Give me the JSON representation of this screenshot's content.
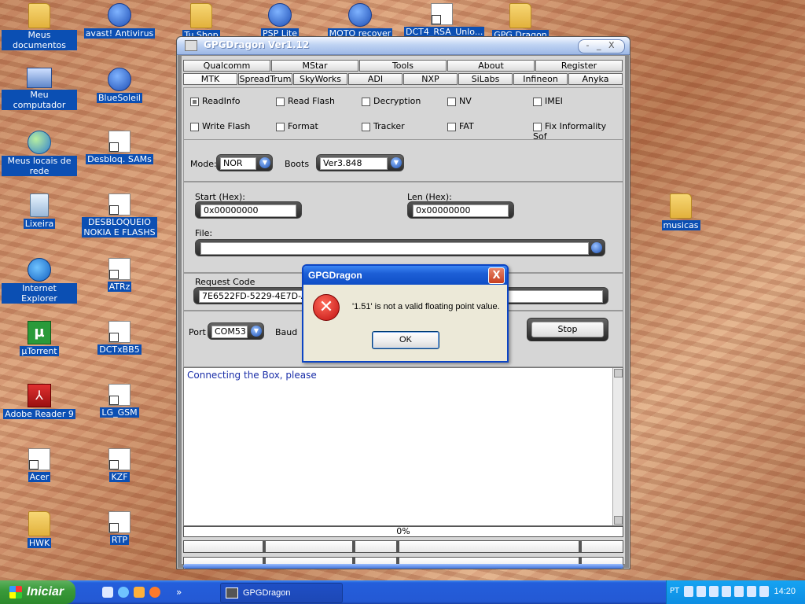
{
  "desktop": {
    "icons": [
      {
        "label": "Meus documentos",
        "icon": "folder-icon"
      },
      {
        "label": "avast! Antivirus",
        "icon": "avast-icon"
      },
      {
        "label": "Meu computador",
        "icon": "computer-icon"
      },
      {
        "label": "BlueSoleil",
        "icon": "bluetooth-icon"
      },
      {
        "label": "Meus locais de rede",
        "icon": "network-icon"
      },
      {
        "label": "Desbloq. SAMs",
        "icon": "shortcut-icon"
      },
      {
        "label": "Lixeira",
        "icon": "recycle-bin-icon"
      },
      {
        "label": "DESBLOQUEIO NOKIA E FLASHS",
        "icon": "shortcut-icon"
      },
      {
        "label": "Internet Explorer",
        "icon": "ie-icon"
      },
      {
        "label": "ATRz",
        "icon": "shortcut-icon"
      },
      {
        "label": "µTorrent",
        "icon": "utorrent-icon"
      },
      {
        "label": "DCTxBB5",
        "icon": "shortcut-icon"
      },
      {
        "label": "Adobe Reader 9",
        "icon": "pdf-icon"
      },
      {
        "label": "LG_GSM",
        "icon": "shortcut-icon"
      },
      {
        "label": "Acer",
        "icon": "shortcut-icon"
      },
      {
        "label": "KZF",
        "icon": "shortcut-icon"
      },
      {
        "label": "HWK",
        "icon": "folder-icon"
      },
      {
        "label": "RTP",
        "icon": "shortcut-icon"
      },
      {
        "label": "musicas",
        "icon": "folder-icon"
      }
    ],
    "top_partial_labels": [
      "Tu Shop",
      "PSP Lite",
      "MOTO recover",
      "DCT4_RSA_Unlo...",
      "GPG Dragon"
    ]
  },
  "window": {
    "title": "GPGDragon Ver1.12",
    "title_buttons": "- _ X",
    "tabs_row1": [
      "Qualcomm",
      "MStar",
      "Tools",
      "About",
      "Register"
    ],
    "tabs_row2": [
      "MTK",
      "SpreadTrum",
      "SkyWorks",
      "ADI",
      "NXP",
      "SiLabs",
      "Infineon",
      "Anyka"
    ],
    "checkboxes": [
      {
        "label": "ReadInfo",
        "checked": true
      },
      {
        "label": "Read Flash",
        "checked": false
      },
      {
        "label": "Decryption",
        "checked": false
      },
      {
        "label": "NV",
        "checked": false
      },
      {
        "label": "IMEI",
        "checked": false
      },
      {
        "label": "Write Flash",
        "checked": false
      },
      {
        "label": "Format",
        "checked": false
      },
      {
        "label": "Tracker",
        "checked": false
      },
      {
        "label": "FAT",
        "checked": false
      },
      {
        "label": "Fix Informality Sof",
        "checked": false
      }
    ],
    "mode_label": "Mode:",
    "mode_value": "NOR",
    "boots_label": "Boots",
    "boots_value": "Ver3.848",
    "start_label": "Start (Hex):",
    "start_value": "0x00000000",
    "len_label": "Len (Hex):",
    "len_value": "0x00000000",
    "file_label": "File:",
    "file_value": "",
    "request_label": "Request Code",
    "request_value": "7E6522FD-5229-4E7D-AD",
    "port_label": "Port",
    "port_value": "COM53",
    "baud_label": "Baud",
    "stop_label": "Stop",
    "log_text": "Connecting the Box, please",
    "progress": "0%"
  },
  "dialog": {
    "title": "GPGDragon",
    "close": "X",
    "message": "'1.51' is not a valid floating point value.",
    "ok": "OK"
  },
  "taskbar": {
    "start": "Iniciar",
    "quick_more": "»",
    "task": "GPGDragon",
    "lang": "PT",
    "clock": "14:20"
  }
}
